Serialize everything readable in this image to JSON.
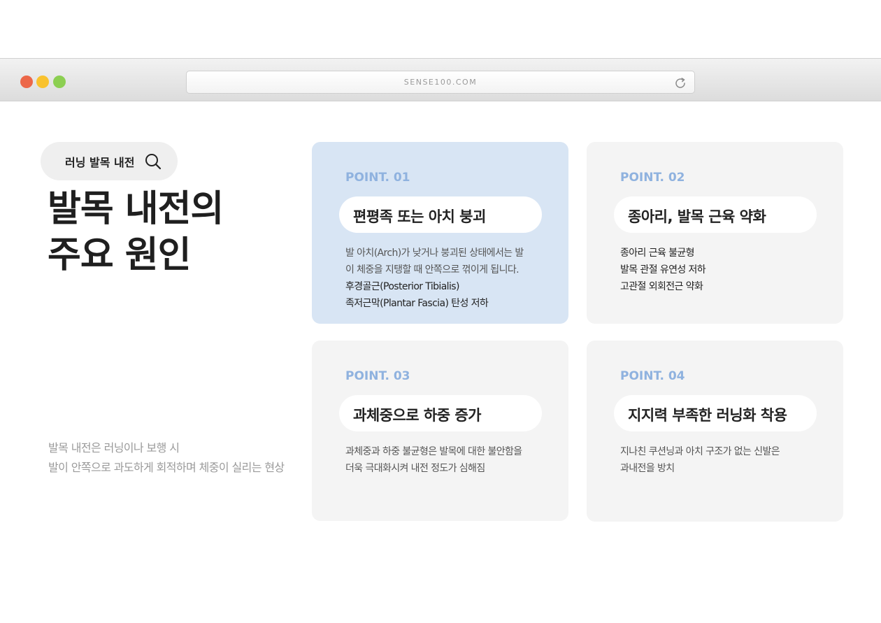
{
  "browser": {
    "url": "SENSE100.COM"
  },
  "search": {
    "label": "러닝 발목 내전"
  },
  "title": {
    "line1": "발목 내전의",
    "line2": "주요 원인"
  },
  "description": {
    "line1": "발목 내전은 러닝이나 보행 시",
    "line2": "발이 안쪽으로 과도하게 회적하며 체중이 실리는 현상"
  },
  "cards": [
    {
      "point": "POINT. 01",
      "heading": "편평족 또는 아치 붕괴",
      "lines": [
        "발 아치(Arch)가 낮거나 붕괴된 상태에서는 발",
        "이 체중을 지탱할 때 안쪽으로 꺾이게 됩니다.",
        "후경골근(Posterior Tibialis)",
        "족저근막(Plantar Fascia) 탄성 저하"
      ]
    },
    {
      "point": "POINT. 02",
      "heading": "종아리, 발목 근육 약화",
      "lines": [
        "종아리 근육 불균형",
        "발목 관절 유연성 저하",
        "고관절 외회전근 약화"
      ]
    },
    {
      "point": "POINT. 03",
      "heading": "과체중으로 하중 증가",
      "lines": [
        "과체중과 하중 불균형은 발목에 대한 불안함을",
        "더욱 극대화시켜 내전 정도가 심해짐"
      ]
    },
    {
      "point": "POINT. 04",
      "heading": "지지력 부족한 러닝화 착용",
      "lines": [
        "지나친 쿠션닝과 아치 구조가 없는 신발은",
        "과내전을 방치"
      ]
    }
  ],
  "colors": {
    "accent": "#8fb2df",
    "active_card": "#d8e5f4",
    "card": "#f4f4f4",
    "dot_red": "#ec6749",
    "dot_yellow": "#f9c22e",
    "dot_green": "#8ccf52"
  }
}
